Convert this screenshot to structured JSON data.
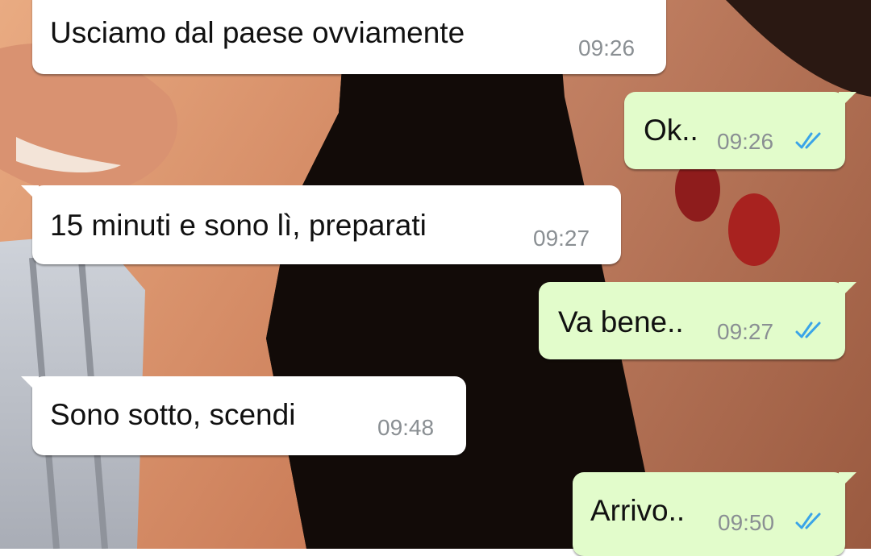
{
  "colors": {
    "incoming_bubble": "#ffffff",
    "outgoing_bubble": "#e2fccb",
    "timestamp": "#8a8f93",
    "read_ticks": "#3aa4e8"
  },
  "messages": [
    {
      "direction": "in",
      "text": "Usciamo dal paese ovviamente",
      "time": "09:26"
    },
    {
      "direction": "out",
      "text": "Ok..",
      "time": "09:26",
      "status_icon": "double-check-icon"
    },
    {
      "direction": "in",
      "text": "15 minuti e sono lì, preparati",
      "time": "09:27"
    },
    {
      "direction": "out",
      "text": "Va bene..",
      "time": "09:27",
      "status_icon": "double-check-icon"
    },
    {
      "direction": "in",
      "text": "Sono sotto, scendi",
      "time": "09:48"
    },
    {
      "direction": "out",
      "text": "Arrivo..",
      "time": "09:50",
      "status_icon": "double-check-icon"
    }
  ]
}
